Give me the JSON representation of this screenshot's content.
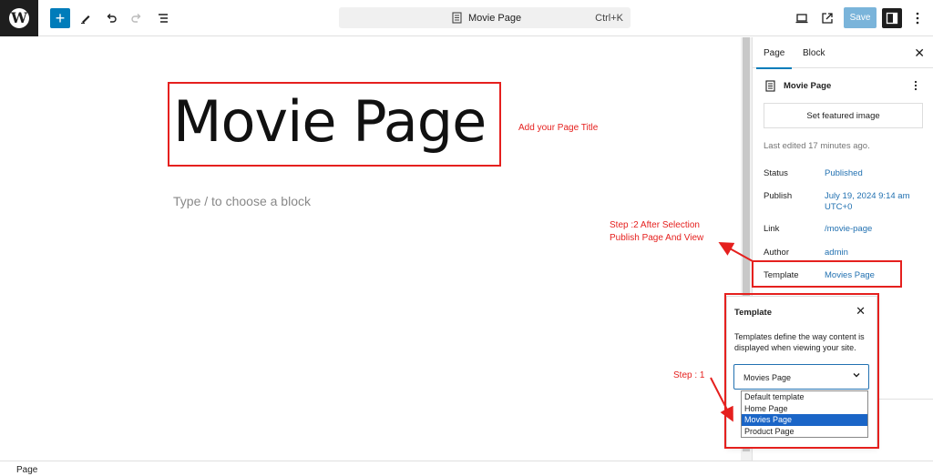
{
  "toolbar": {
    "logo": "W",
    "add_icon": "+",
    "doc_title": "Movie Page",
    "shortcut": "Ctrl+K",
    "save_label": "Save"
  },
  "canvas": {
    "page_title": "Movie Page",
    "block_placeholder": "Type / to choose a block"
  },
  "annotations": {
    "title_note": "Add your Page Title",
    "step2_line1": "Step :2 After Selection",
    "step2_line2": "Publish Page And View",
    "step1": "Step : 1"
  },
  "sidebar": {
    "tabs": [
      "Page",
      "Block"
    ],
    "close_icon": "✕",
    "doc_name": "Movie Page",
    "featured_image_label": "Set featured image",
    "last_edited": "Last edited 17 minutes ago.",
    "status_label": "Status",
    "status_value": "Published",
    "publish_label": "Publish",
    "publish_value_1": "July 19, 2024 9:14 am",
    "publish_value_2": "UTC+0",
    "link_label": "Link",
    "link_value": "/movie-page",
    "author_label": "Author",
    "author_value": "admin",
    "template_label": "Template",
    "template_value": "Movies Page"
  },
  "template_popover": {
    "title": "Template",
    "close_icon": "✕",
    "description": "Templates define the way content is displayed when viewing your site.",
    "selected": "Movies Page",
    "options": [
      "Default template",
      "Home Page",
      "Movies Page",
      "Product Page"
    ]
  },
  "footer": {
    "breadcrumb": "Page"
  },
  "colors": {
    "accent": "#007cba",
    "annotation": "#e5201e",
    "link": "#2271b1"
  }
}
